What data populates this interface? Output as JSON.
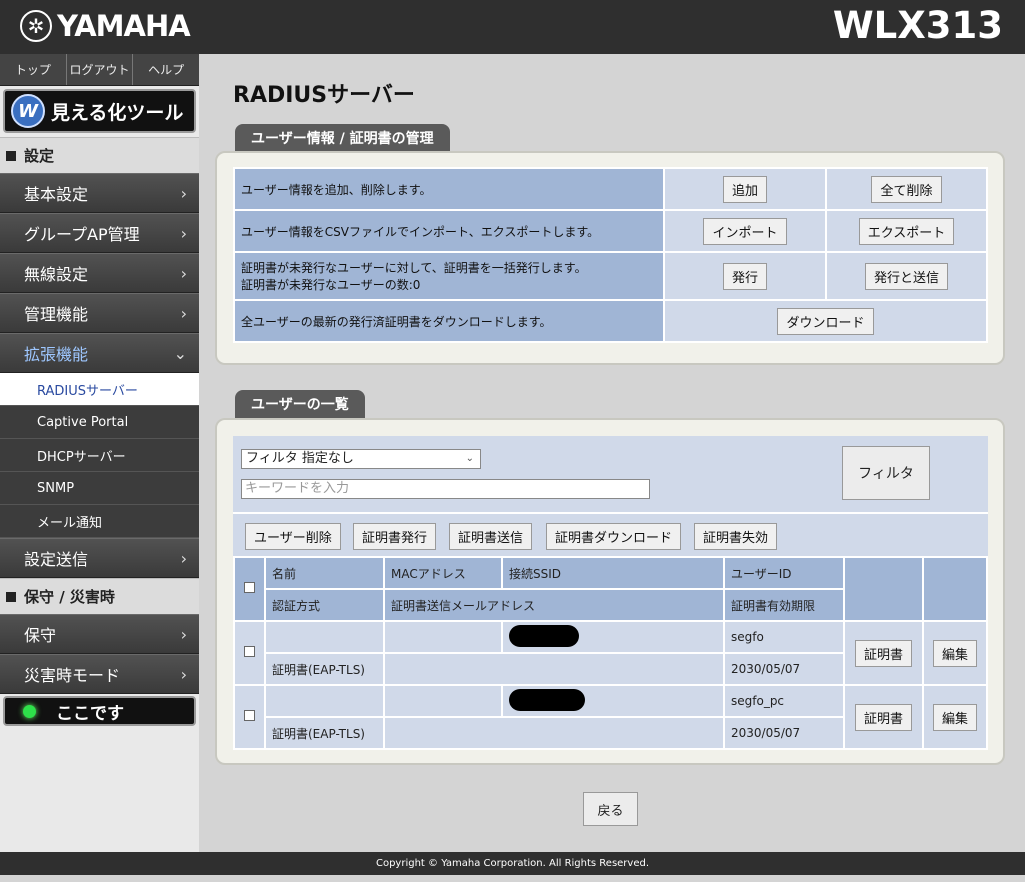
{
  "header": {
    "brand": "YAMAHA",
    "model": "WLX313"
  },
  "sidebar": {
    "topnav": [
      "トップ",
      "ログアウト",
      "ヘルプ"
    ],
    "tool_button": "見える化ツール",
    "section_settings": "設定",
    "menu": [
      {
        "label": "基本設定"
      },
      {
        "label": "グループAP管理"
      },
      {
        "label": "無線設定"
      },
      {
        "label": "管理機能"
      },
      {
        "label": "拡張機能"
      }
    ],
    "submenu": [
      "RADIUSサーバー",
      "Captive Portal",
      "DHCPサーバー",
      "SNMP",
      "メール通知"
    ],
    "menu_send": "設定送信",
    "section_maint": "保守 / 災害時",
    "menu_maint": "保守",
    "menu_disaster": "災害時モード",
    "here_button": "ここです"
  },
  "main": {
    "title": "RADIUSサーバー",
    "mgmt_tab": "ユーザー情報 / 証明書の管理",
    "mgmt_rows": [
      {
        "desc": "ユーザー情報を追加、削除します。",
        "btn1": "追加",
        "btn2": "全て削除"
      },
      {
        "desc": "ユーザー情報をCSVファイルでインポート、エクスポートします。",
        "btn1": "インポート",
        "btn2": "エクスポート"
      },
      {
        "desc1": "証明書が未発行なユーザーに対して、証明書を一括発行します。",
        "desc2": "証明書が未発行なユーザーの数:0",
        "btn1": "発行",
        "btn2": "発行と送信"
      },
      {
        "desc": "全ユーザーの最新の発行済証明書をダウンロードします。",
        "btn1": "ダウンロード"
      }
    ],
    "list_tab": "ユーザーの一覧",
    "filter": {
      "select_value": "フィルタ 指定なし",
      "keyword_placeholder": "キーワードを入力",
      "filter_button": "フィルタ"
    },
    "actions": [
      "ユーザー削除",
      "証明書発行",
      "証明書送信",
      "証明書ダウンロード",
      "証明書失効"
    ],
    "table_headers": {
      "name": "名前",
      "mac": "MACアドレス",
      "ssid": "接続SSID",
      "user_id": "ユーザーID",
      "auth": "認証方式",
      "mail": "証明書送信メールアドレス",
      "expiry": "証明書有効期限"
    },
    "users": [
      {
        "user_id": "segfo",
        "auth": "証明書(EAP-TLS)",
        "expiry": "2030/05/07",
        "cert_btn": "証明書",
        "edit_btn": "編集"
      },
      {
        "user_id": "segfo_pc",
        "auth": "証明書(EAP-TLS)",
        "expiry": "2030/05/07",
        "cert_btn": "証明書",
        "edit_btn": "編集"
      }
    ],
    "back_button": "戻る"
  },
  "footer": {
    "copyright": "Copyright © Yamaha Corporation. All Rights Reserved."
  }
}
